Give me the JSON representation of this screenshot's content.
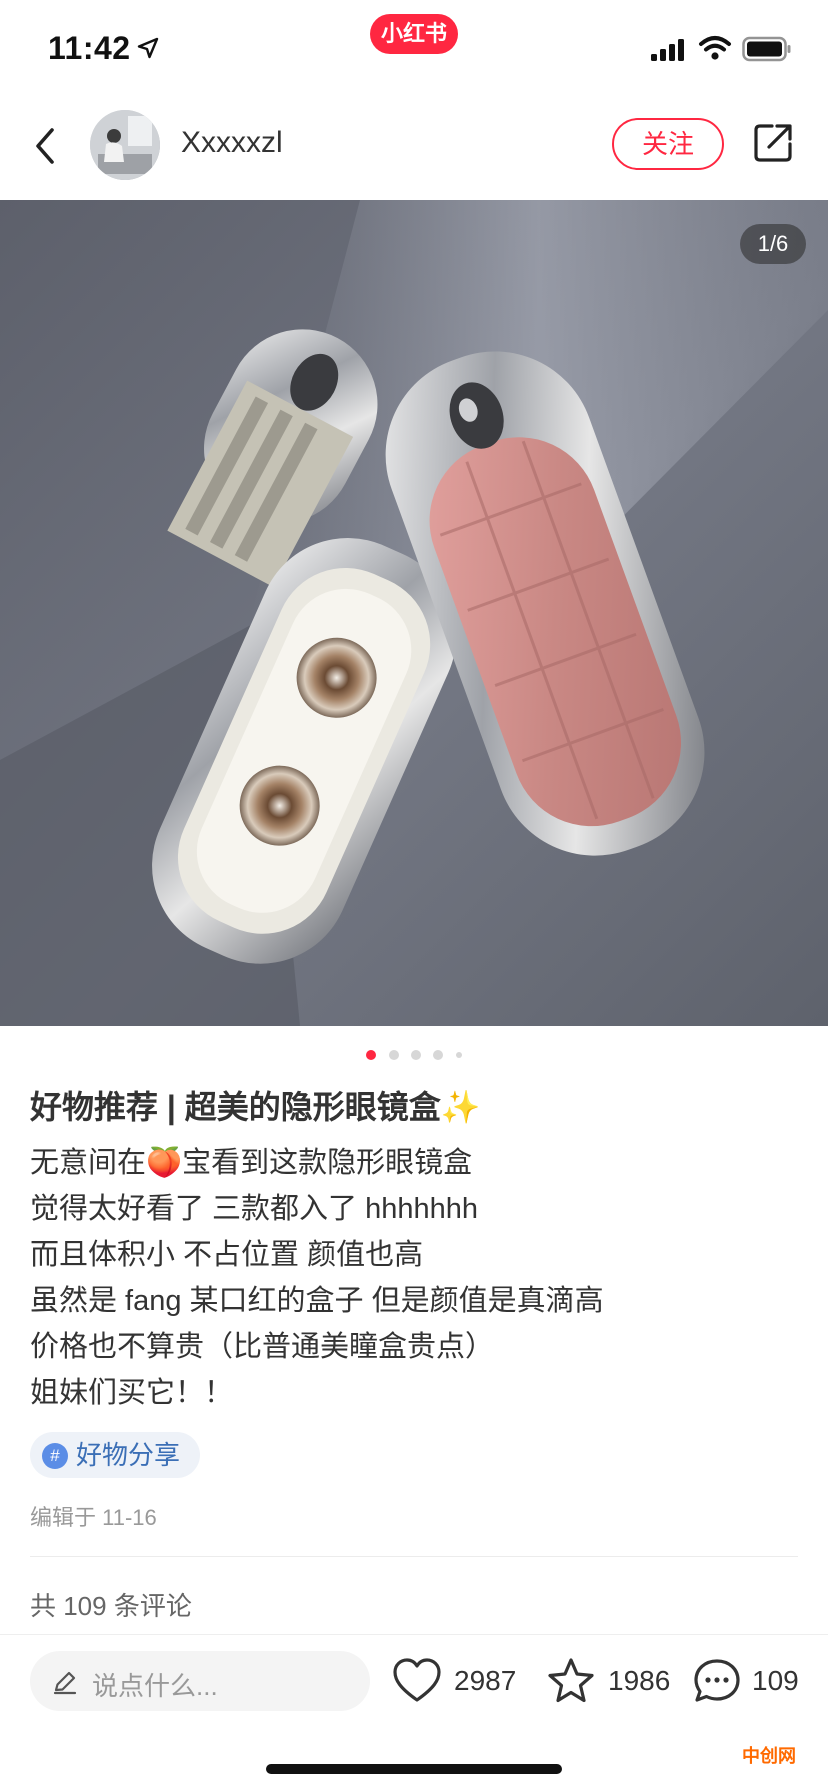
{
  "status_bar": {
    "time": "11:42",
    "brand": "小红书",
    "brand_color": "#ff2741"
  },
  "nav": {
    "username": "Xxxxxzl",
    "follow_label": "关注",
    "back_icon": "chevron-left-icon",
    "share_icon": "share-icon"
  },
  "gallery": {
    "counter": "1/6",
    "current_index": 1,
    "total": 6
  },
  "post": {
    "title": "好物推荐 | 超美的隐形眼镜盒✨",
    "lines": [
      "无意间在🍑宝看到这款隐形眼镜盒",
      "觉得太好看了  三款都入了 hhhhhhh",
      "而且体积小 不占位置  颜值也高",
      "虽然是 fang 某口红的盒子  但是颜值是真滴高",
      "价格也不算贵（比普通美瞳盒贵点）",
      "姐妹们买它！！"
    ],
    "tag_symbol": "#",
    "tag": "好物分享",
    "edited": "编辑于 11-16"
  },
  "comments": {
    "total_text": "共 109 条评论"
  },
  "bottom_bar": {
    "input_placeholder": "说点什么...",
    "likes": "2987",
    "collects": "1986",
    "comments": "109"
  },
  "watermark": "中创网"
}
